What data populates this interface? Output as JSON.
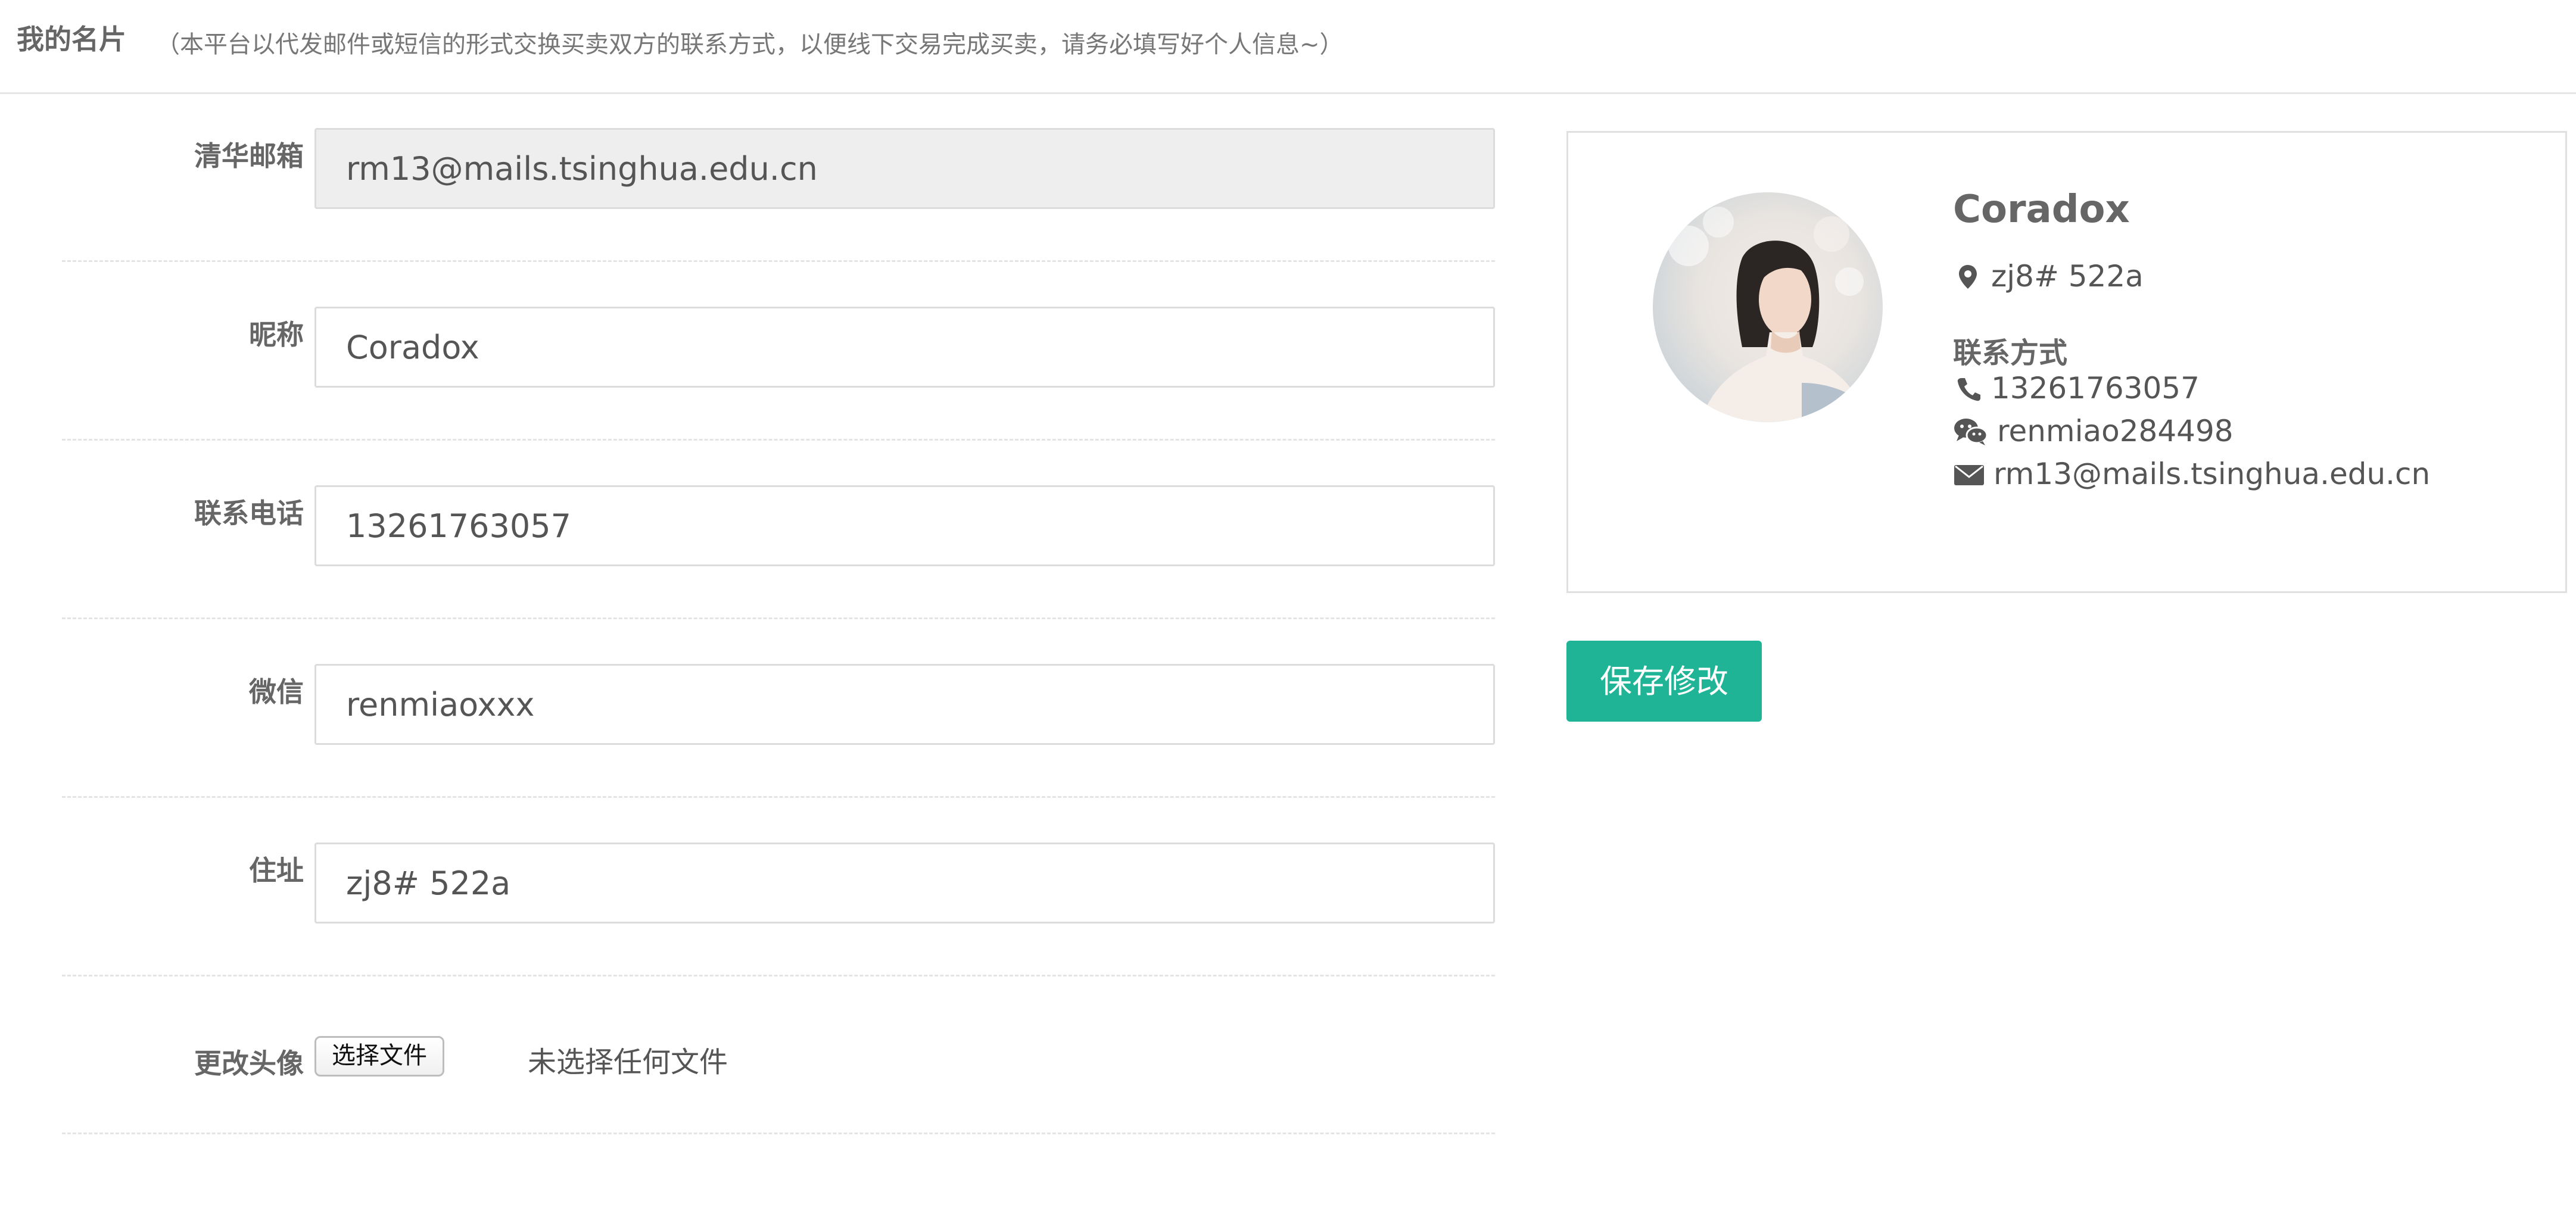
{
  "header": {
    "title": "我的名片",
    "note": "（本平台以代发邮件或短信的形式交换买卖双方的联系方式，以便线下交易完成买卖，请务必填写好个人信息~）"
  },
  "form": {
    "email": {
      "label": "清华邮箱",
      "value": "rm13@mails.tsinghua.edu.cn"
    },
    "nickname": {
      "label": "昵称",
      "value": "Coradox"
    },
    "phone": {
      "label": "联系电话",
      "value": "13261763057"
    },
    "wechat": {
      "label": "微信",
      "value": "renmiaoxxx"
    },
    "address": {
      "label": "住址",
      "value": "zj8# 522a"
    },
    "avatar": {
      "label": "更改头像",
      "button_label": "选择文件",
      "status": "未选择任何文件"
    }
  },
  "card": {
    "name": "Coradox",
    "address": "zj8# 522a",
    "contact_heading": "联系方式",
    "phone": "13261763057",
    "wechat": "renmiao284498",
    "email": "rm13@mails.tsinghua.edu.cn"
  },
  "save_button_label": "保存修改",
  "colors": {
    "accent": "#1fb496",
    "border": "#dcdcdc",
    "readonly_bg": "#eeeeee"
  },
  "icons": [
    "map-marker-icon",
    "phone-icon",
    "wechat-icon",
    "envelope-icon"
  ]
}
